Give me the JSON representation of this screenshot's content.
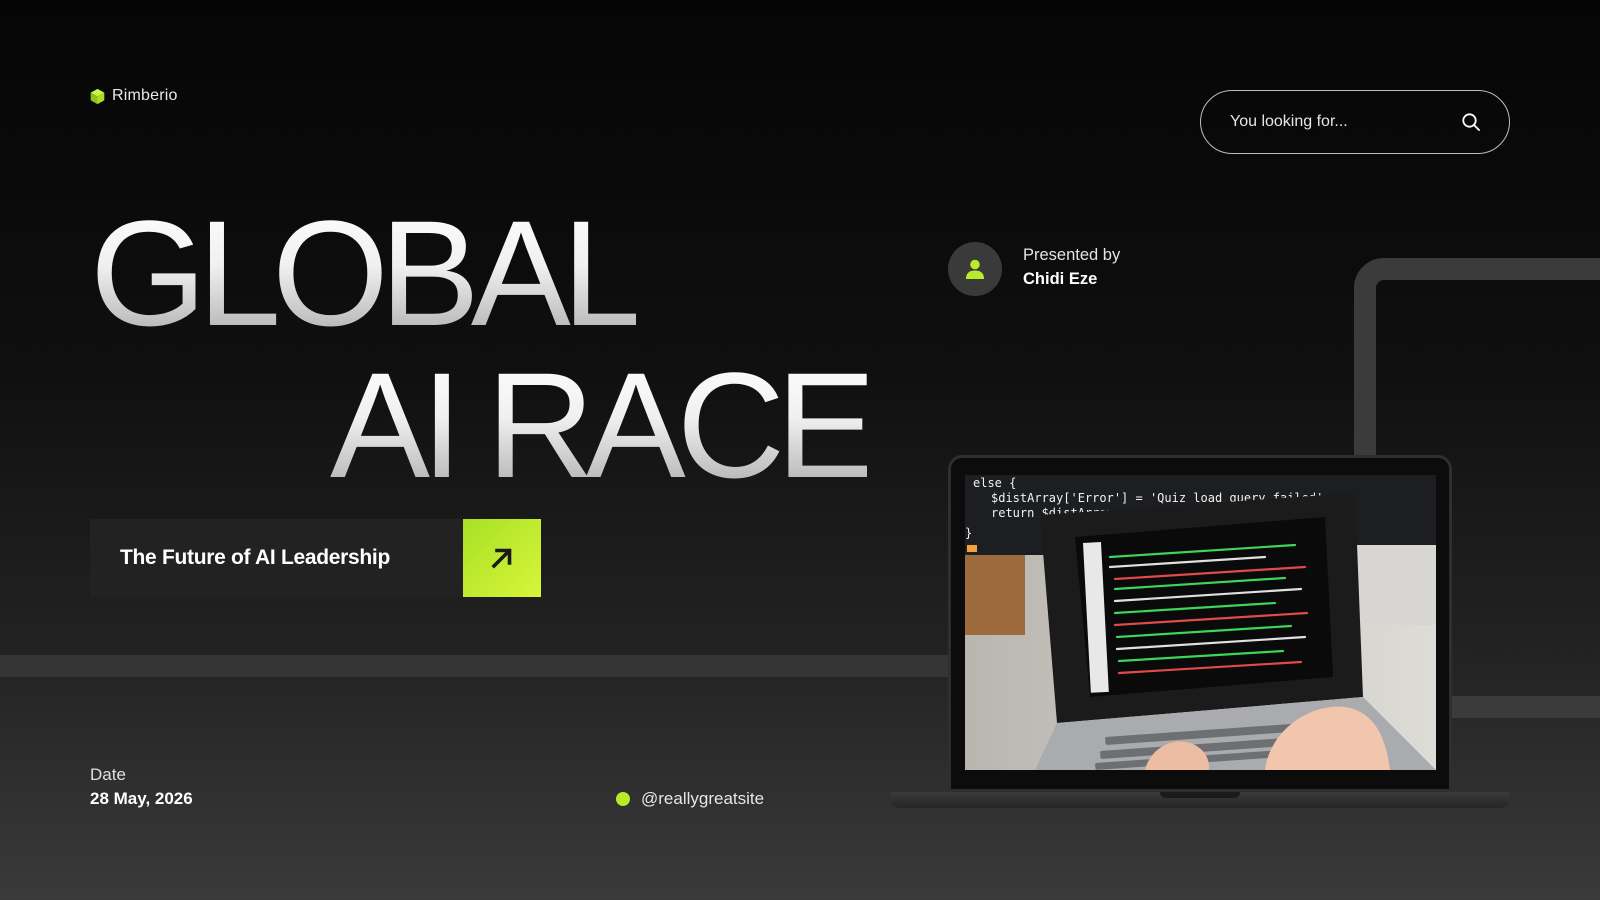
{
  "brand": {
    "name": "Rimberio",
    "icon": "cube-icon",
    "accent": "#b8ec2a"
  },
  "search": {
    "placeholder": "You looking for...",
    "icon": "search-icon"
  },
  "hero": {
    "line1": "GLOBAL",
    "line2": "AI RACE"
  },
  "subtitle": {
    "text": "The Future of AI Leadership",
    "button_icon": "arrow-up-right-icon"
  },
  "presenter": {
    "label": "Presented by",
    "name": "Chidi Eze",
    "icon": "user-icon"
  },
  "footer": {
    "date_label": "Date",
    "date_value": "28 May, 2026",
    "social_handle": "@reallygreatsite"
  },
  "photo": {
    "code_lines": [
      "else {",
      "$distArray['Error'] = 'Quiz load query failed';",
      "return $distArray;",
      "}"
    ]
  }
}
